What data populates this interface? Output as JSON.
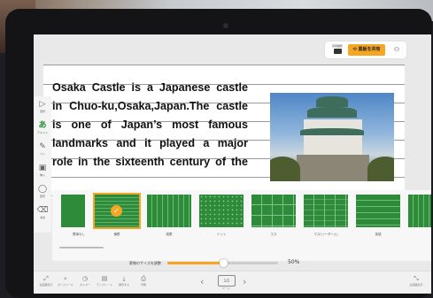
{
  "toolbar": {
    "camera_label": "写真撮影",
    "share_label": "黒板を共有",
    "person_icon": "person-icon",
    "accent": "#f5a623"
  },
  "document": {
    "lines": [
      "Osaka Castle is a Japanese castle",
      "in Chuo-ku,Osaka,Japan.The castle",
      "is one of Japan’s most famous",
      "landmarks and it played a major",
      "role in the sixteenth century of the"
    ],
    "image": "osaka-castle-photo"
  },
  "left_tools": [
    {
      "icon": "pointer-icon",
      "label": "選択"
    },
    {
      "icon": "text-icon",
      "label": "テキスト",
      "active": true
    },
    {
      "icon": "pen-icon",
      "label": "ペン"
    },
    {
      "icon": "image-icon",
      "label": "挿入"
    },
    {
      "icon": "shape-icon",
      "label": "図形"
    },
    {
      "icon": "eraser-icon",
      "label": "消去"
    }
  ],
  "ruling_options": [
    {
      "label": "罫線なし",
      "pattern": "none"
    },
    {
      "label": "横罫",
      "pattern": "horizontal",
      "selected": true
    },
    {
      "label": "縦罫",
      "pattern": "vertical"
    },
    {
      "label": "ドット",
      "pattern": "dot"
    },
    {
      "label": "マス",
      "pattern": "grid"
    },
    {
      "label": "マス(リーダー入)",
      "pattern": "grid-leader"
    },
    {
      "label": "英語",
      "pattern": "english"
    },
    {
      "label": "",
      "pattern": "partial"
    }
  ],
  "size_control": {
    "label": "罫線のサイズを調整",
    "value_text": "50%",
    "value": 0.5
  },
  "bottom_bar": {
    "left": [
      {
        "icon": "expand-icon",
        "label": "全画面表示"
      },
      {
        "icon": "zoom-icon",
        "label": "ズームツール"
      },
      {
        "icon": "timer-icon",
        "label": "タイマー"
      },
      {
        "icon": "template-icon",
        "label": "テンプレート"
      },
      {
        "icon": "save-icon",
        "label": "保存する"
      },
      {
        "icon": "print-icon",
        "label": "印刷"
      }
    ],
    "prev": "‹",
    "next": "›",
    "page_indicator": "1/1",
    "page_label": "ページ",
    "right": {
      "icon": "fullscreen-icon",
      "label": "全画面表示"
    }
  }
}
